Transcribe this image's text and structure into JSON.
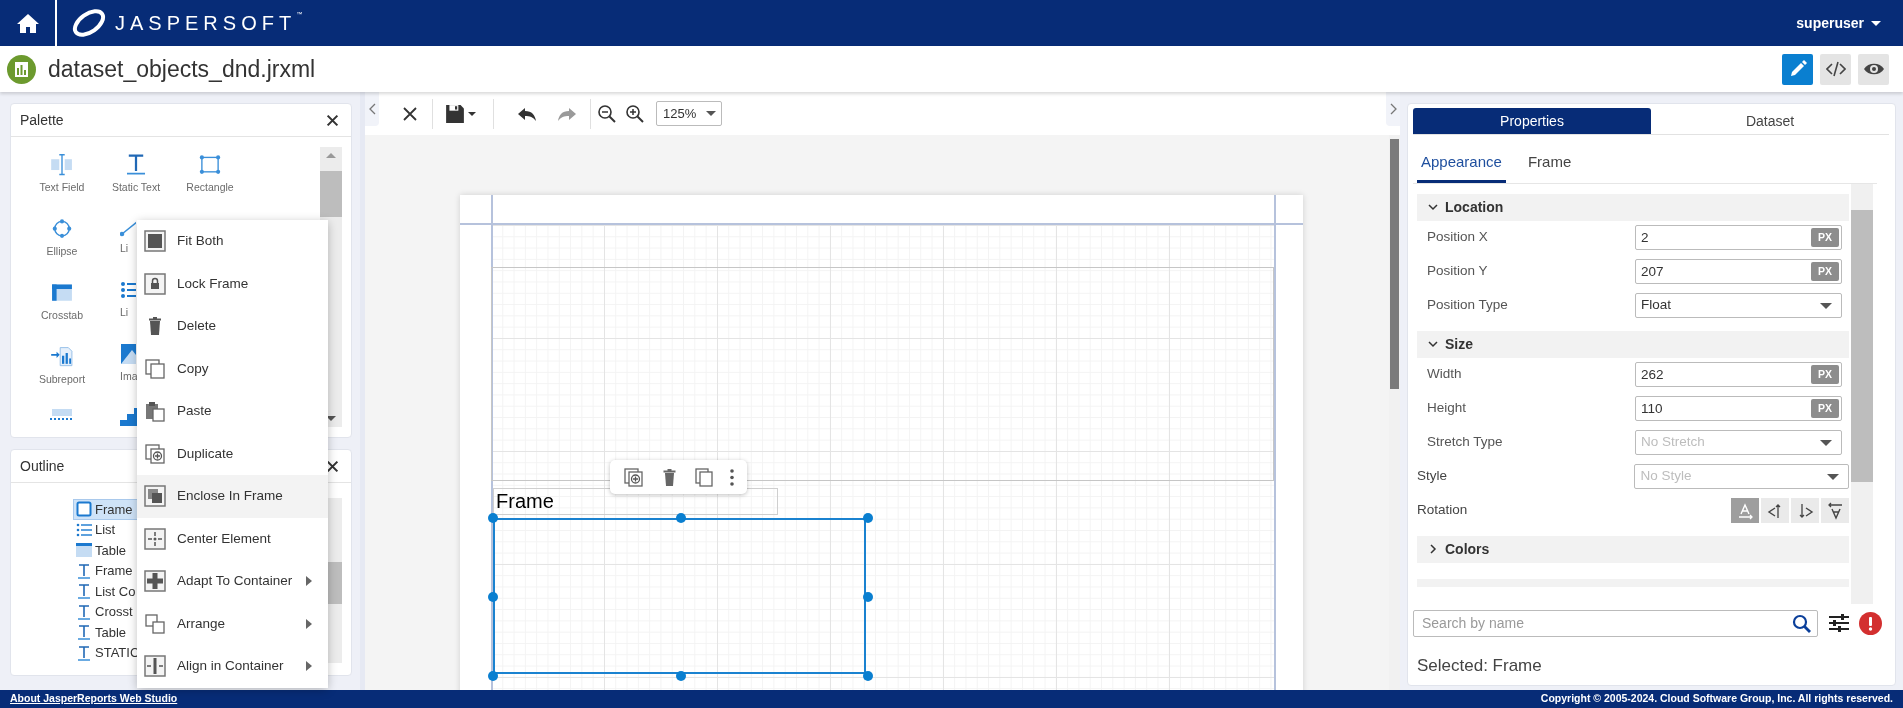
{
  "header": {
    "logo": "JASPERSOFT",
    "trademark": "™",
    "user": "superuser"
  },
  "document": {
    "title": "dataset_objects_dnd.jrxml",
    "modes": [
      {
        "kind": "design",
        "selected": true
      },
      {
        "kind": "source",
        "selected": false
      },
      {
        "kind": "preview",
        "selected": false
      }
    ]
  },
  "palette": {
    "title": "Palette",
    "items": [
      {
        "kind": "text-field",
        "label": "Text Field"
      },
      {
        "kind": "static-text",
        "label": "Static Text"
      },
      {
        "kind": "rectangle",
        "label": "Rectangle"
      },
      {
        "kind": "ellipse",
        "label": "Ellipse"
      },
      {
        "kind": "line",
        "label": "Li"
      },
      {
        "kind": "crosstab",
        "label": "Crosstab"
      },
      {
        "kind": "list",
        "label": "Li"
      },
      {
        "kind": "subreport",
        "label": "Subreport"
      },
      {
        "kind": "image",
        "label": "Ima"
      },
      {
        "kind": "dashed"
      },
      {
        "kind": "steps"
      }
    ]
  },
  "outline": {
    "title": "Outline",
    "items": [
      {
        "kind": "frame",
        "label": "Frame",
        "selected": true
      },
      {
        "kind": "list",
        "label": "List",
        "selected": false
      },
      {
        "kind": "table",
        "label": "Table",
        "selected": false
      },
      {
        "kind": "text",
        "label": "Frame",
        "selected": false
      },
      {
        "kind": "text",
        "label": "List Co",
        "selected": false
      },
      {
        "kind": "text",
        "label": "Crosst",
        "selected": false
      },
      {
        "kind": "text",
        "label": "Table",
        "selected": false
      },
      {
        "kind": "text",
        "label": "STATIC",
        "selected": false
      }
    ]
  },
  "context_menu": {
    "items": [
      {
        "kind": "fit-both",
        "label": "Fit Both",
        "hovered": false,
        "submenu": false
      },
      {
        "kind": "lock",
        "label": "Lock Frame",
        "hovered": false,
        "submenu": false
      },
      {
        "kind": "delete",
        "label": "Delete",
        "hovered": false,
        "submenu": false
      },
      {
        "kind": "copy",
        "label": "Copy",
        "hovered": false,
        "submenu": false
      },
      {
        "kind": "paste",
        "label": "Paste",
        "hovered": false,
        "submenu": false
      },
      {
        "kind": "duplicate",
        "label": "Duplicate",
        "hovered": false,
        "submenu": false
      },
      {
        "kind": "enclose",
        "label": "Enclose In Frame",
        "hovered": true,
        "submenu": false
      },
      {
        "kind": "center",
        "label": "Center Element",
        "hovered": false,
        "submenu": false
      },
      {
        "kind": "adapt",
        "label": "Adapt To Container",
        "hovered": false,
        "submenu": true
      },
      {
        "kind": "arrange",
        "label": "Arrange",
        "hovered": false,
        "submenu": true
      },
      {
        "kind": "align",
        "label": "Align in Container",
        "hovered": false,
        "submenu": true
      }
    ]
  },
  "toolbar": {
    "buttons": [
      {
        "kind": "close",
        "disabled": false
      },
      {
        "kind": "save",
        "disabled": false
      },
      {
        "kind": "undo",
        "disabled": false
      },
      {
        "kind": "redo",
        "disabled": true
      },
      {
        "kind": "zoom-out",
        "disabled": false
      },
      {
        "kind": "zoom-in",
        "disabled": false
      }
    ],
    "zoom": "125%"
  },
  "canvas": {
    "elements": [
      {
        "kind": "label",
        "text": "Frame"
      },
      {
        "kind": "frame",
        "selected": true
      }
    ]
  },
  "properties": {
    "tabs": [
      {
        "label": "Properties",
        "selected": true
      },
      {
        "label": "Dataset",
        "selected": false
      }
    ],
    "subtabs": [
      {
        "label": "Appearance",
        "selected": true
      },
      {
        "label": "Frame",
        "selected": false
      }
    ],
    "items": [
      {
        "kind": "section",
        "title": "Location",
        "expanded": true,
        "rows": [
          {
            "kind": "number",
            "label": "Position X",
            "value": "2",
            "unit": "PX"
          },
          {
            "kind": "number",
            "label": "Position Y",
            "value": "207",
            "unit": "PX"
          },
          {
            "kind": "select",
            "label": "Position Type",
            "value": "Float"
          }
        ]
      },
      {
        "kind": "section",
        "title": "Size",
        "expanded": true,
        "rows": [
          {
            "kind": "number",
            "label": "Width",
            "value": "262",
            "unit": "PX"
          },
          {
            "kind": "number",
            "label": "Height",
            "value": "110",
            "unit": "PX"
          },
          {
            "kind": "select",
            "label": "Stretch Type",
            "placeholder": "No Stretch"
          }
        ]
      },
      {
        "kind": "select",
        "label": "Style",
        "placeholder": "No Style"
      },
      {
        "kind": "rotation",
        "label": "Rotation",
        "options": [
          {
            "kind": "none",
            "selected": true
          },
          {
            "kind": "left",
            "selected": false
          },
          {
            "kind": "right",
            "selected": false
          },
          {
            "kind": "upside-down",
            "selected": false
          }
        ]
      },
      {
        "kind": "section",
        "title": "Colors",
        "expanded": false
      }
    ],
    "search": {
      "placeholder": "Search by name"
    },
    "selected_text": "Selected: Frame"
  },
  "footer": {
    "about_link": "About JasperReports Web Studio",
    "copyright": "Copyright © 2005-2024. Cloud Software Group, Inc. All rights reserved."
  }
}
